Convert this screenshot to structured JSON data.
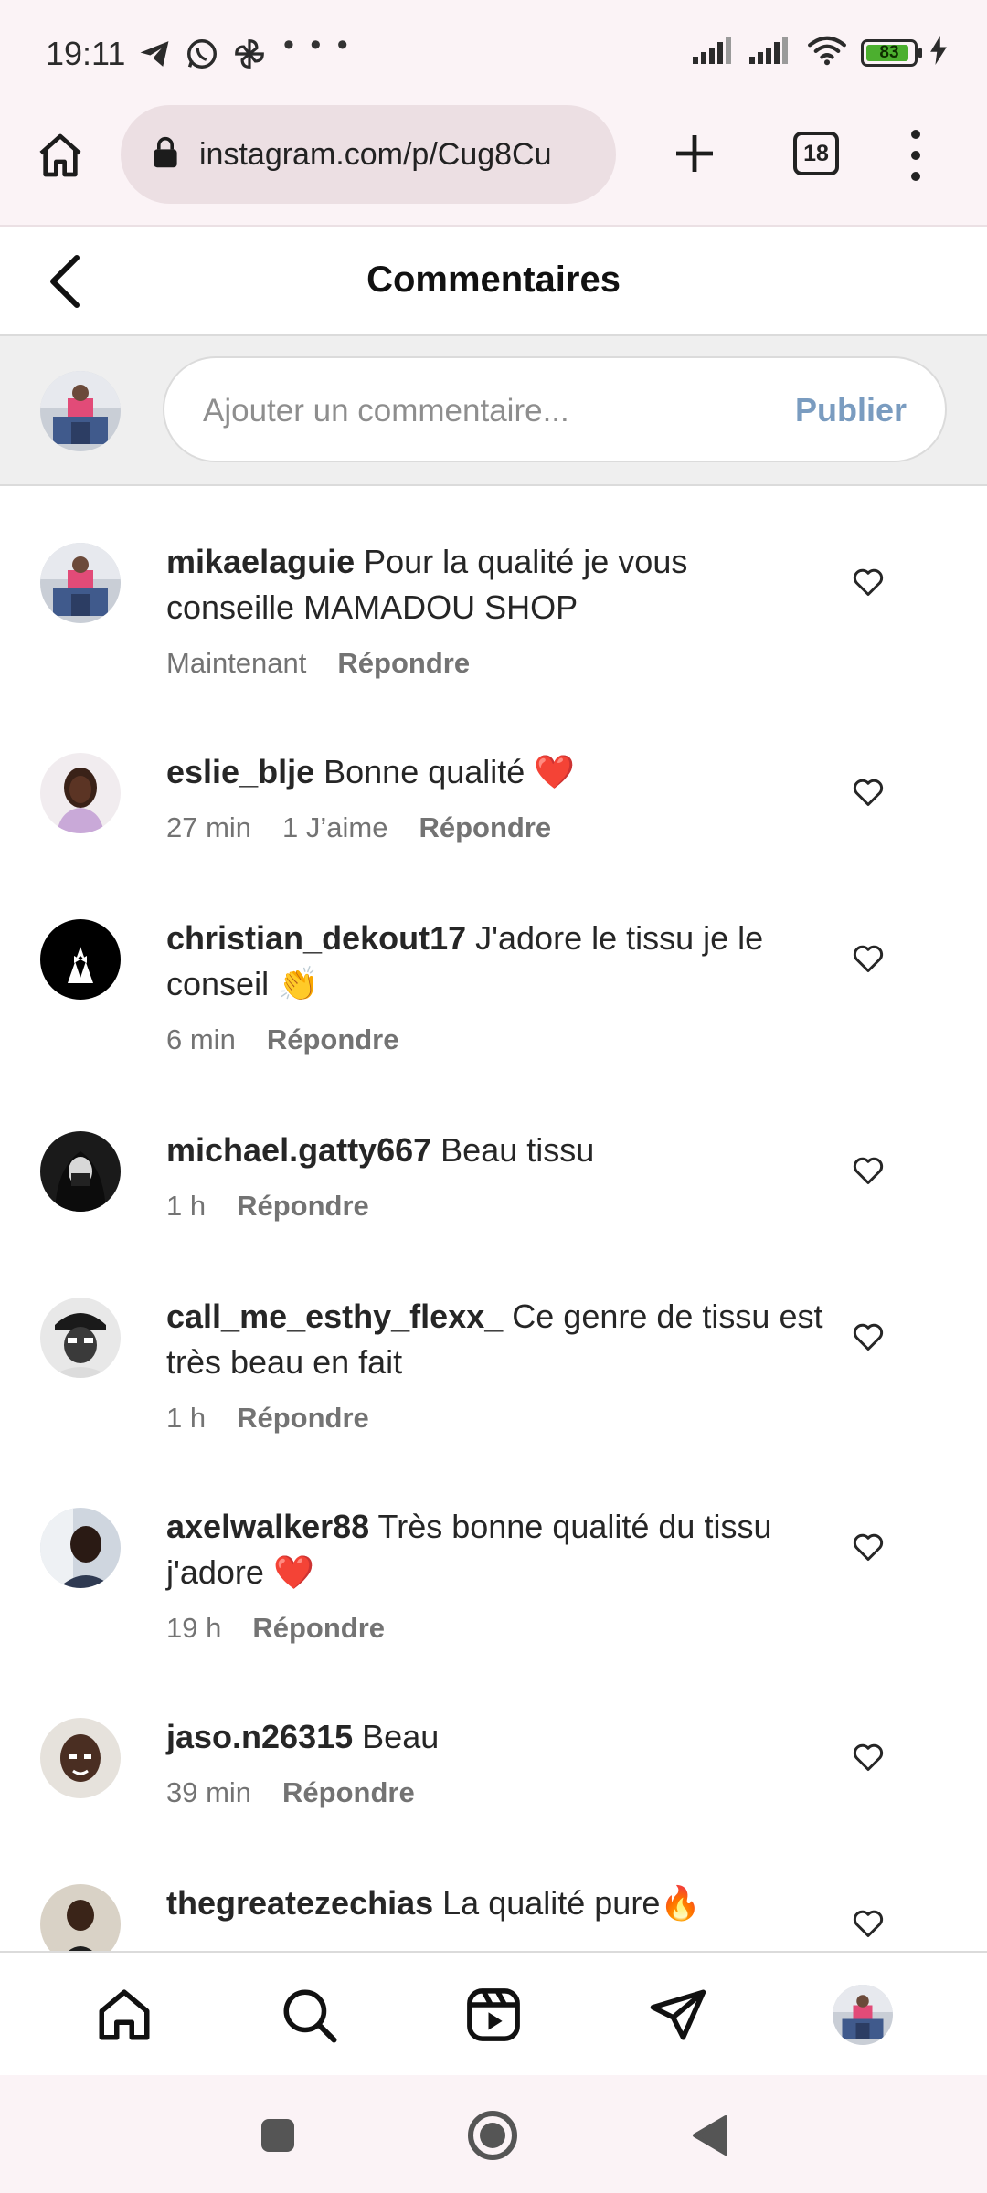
{
  "status_bar": {
    "time": "19:11",
    "dots": "• • •",
    "battery_level": "83",
    "battery_fraction": 0.83
  },
  "browser": {
    "url": "instagram.com/p/Cug8Cu",
    "tab_count": "18"
  },
  "header": {
    "title": "Commentaires"
  },
  "composer": {
    "placeholder": "Ajouter un commentaire...",
    "publish_label": "Publier"
  },
  "comments": [
    {
      "username": "mikaelaguie",
      "text": "Pour la qualité je vous conseille MAMADOU SHOP",
      "time": "Maintenant",
      "likes": "",
      "reply": "Répondre",
      "avatar": "self"
    },
    {
      "username": "eslie_blje",
      "text": "Bonne qualité ❤️",
      "time": "27 min",
      "likes": "1 J’aime",
      "reply": "Répondre",
      "avatar": "woman"
    },
    {
      "username": "christian_dekout17",
      "text": "J'adore le tissu je le conseil 👏",
      "time": "6 min",
      "likes": "",
      "reply": "Répondre",
      "avatar": "suit"
    },
    {
      "username": "michael.gatty667",
      "text": "Beau tissu",
      "time": "1 h",
      "likes": "",
      "reply": "Répondre",
      "avatar": "hooded"
    },
    {
      "username": "call_me_esthy_flexx_",
      "text": "Ce genre de tissu est très beau en fait",
      "time": "1 h",
      "likes": "",
      "reply": "Répondre",
      "avatar": "cap"
    },
    {
      "username": "axelwalker88",
      "text": "Très bonne qualité du tissu j'adore ❤️",
      "time": "19 h",
      "likes": "",
      "reply": "Répondre",
      "avatar": "man"
    },
    {
      "username": "jaso.n26315",
      "text": "Beau",
      "time": "39 min",
      "likes": "",
      "reply": "Répondre",
      "avatar": "boy"
    },
    {
      "username": "thegreatezechias",
      "text": "La qualité pure🔥",
      "time": "",
      "likes": "",
      "reply": "",
      "avatar": "kid"
    }
  ],
  "icons": {
    "status_left": [
      "telegram-icon",
      "whatsapp-icon",
      "pinwheel-icon"
    ],
    "status_right": [
      "signal-icon",
      "signal-icon",
      "wifi-icon",
      "battery-icon",
      "charging-icon"
    ],
    "bottom_nav": [
      "home-icon",
      "search-icon",
      "reels-icon",
      "direct-icon",
      "profile-avatar"
    ],
    "system_nav": [
      "recents-icon",
      "home-circle-icon",
      "back-triangle-icon"
    ]
  },
  "colors": {
    "accent_publish": "#7a9cc0",
    "heart_red": "#e0245e",
    "browser_bg": "#fbf3f6"
  }
}
